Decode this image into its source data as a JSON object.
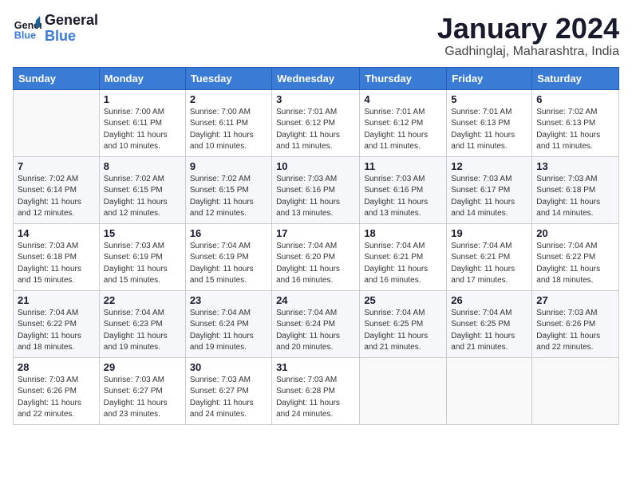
{
  "header": {
    "logo_line1": "General",
    "logo_line2": "Blue",
    "title": "January 2024",
    "location": "Gadhinglaj, Maharashtra, India"
  },
  "days_of_week": [
    "Sunday",
    "Monday",
    "Tuesday",
    "Wednesday",
    "Thursday",
    "Friday",
    "Saturday"
  ],
  "weeks": [
    [
      {
        "num": "",
        "info": ""
      },
      {
        "num": "1",
        "info": "Sunrise: 7:00 AM\nSunset: 6:11 PM\nDaylight: 11 hours\nand 10 minutes."
      },
      {
        "num": "2",
        "info": "Sunrise: 7:00 AM\nSunset: 6:11 PM\nDaylight: 11 hours\nand 10 minutes."
      },
      {
        "num": "3",
        "info": "Sunrise: 7:01 AM\nSunset: 6:12 PM\nDaylight: 11 hours\nand 11 minutes."
      },
      {
        "num": "4",
        "info": "Sunrise: 7:01 AM\nSunset: 6:12 PM\nDaylight: 11 hours\nand 11 minutes."
      },
      {
        "num": "5",
        "info": "Sunrise: 7:01 AM\nSunset: 6:13 PM\nDaylight: 11 hours\nand 11 minutes."
      },
      {
        "num": "6",
        "info": "Sunrise: 7:02 AM\nSunset: 6:13 PM\nDaylight: 11 hours\nand 11 minutes."
      }
    ],
    [
      {
        "num": "7",
        "info": "Sunrise: 7:02 AM\nSunset: 6:14 PM\nDaylight: 11 hours\nand 12 minutes."
      },
      {
        "num": "8",
        "info": "Sunrise: 7:02 AM\nSunset: 6:15 PM\nDaylight: 11 hours\nand 12 minutes."
      },
      {
        "num": "9",
        "info": "Sunrise: 7:02 AM\nSunset: 6:15 PM\nDaylight: 11 hours\nand 12 minutes."
      },
      {
        "num": "10",
        "info": "Sunrise: 7:03 AM\nSunset: 6:16 PM\nDaylight: 11 hours\nand 13 minutes."
      },
      {
        "num": "11",
        "info": "Sunrise: 7:03 AM\nSunset: 6:16 PM\nDaylight: 11 hours\nand 13 minutes."
      },
      {
        "num": "12",
        "info": "Sunrise: 7:03 AM\nSunset: 6:17 PM\nDaylight: 11 hours\nand 14 minutes."
      },
      {
        "num": "13",
        "info": "Sunrise: 7:03 AM\nSunset: 6:18 PM\nDaylight: 11 hours\nand 14 minutes."
      }
    ],
    [
      {
        "num": "14",
        "info": "Sunrise: 7:03 AM\nSunset: 6:18 PM\nDaylight: 11 hours\nand 15 minutes."
      },
      {
        "num": "15",
        "info": "Sunrise: 7:03 AM\nSunset: 6:19 PM\nDaylight: 11 hours\nand 15 minutes."
      },
      {
        "num": "16",
        "info": "Sunrise: 7:04 AM\nSunset: 6:19 PM\nDaylight: 11 hours\nand 15 minutes."
      },
      {
        "num": "17",
        "info": "Sunrise: 7:04 AM\nSunset: 6:20 PM\nDaylight: 11 hours\nand 16 minutes."
      },
      {
        "num": "18",
        "info": "Sunrise: 7:04 AM\nSunset: 6:21 PM\nDaylight: 11 hours\nand 16 minutes."
      },
      {
        "num": "19",
        "info": "Sunrise: 7:04 AM\nSunset: 6:21 PM\nDaylight: 11 hours\nand 17 minutes."
      },
      {
        "num": "20",
        "info": "Sunrise: 7:04 AM\nSunset: 6:22 PM\nDaylight: 11 hours\nand 18 minutes."
      }
    ],
    [
      {
        "num": "21",
        "info": "Sunrise: 7:04 AM\nSunset: 6:22 PM\nDaylight: 11 hours\nand 18 minutes."
      },
      {
        "num": "22",
        "info": "Sunrise: 7:04 AM\nSunset: 6:23 PM\nDaylight: 11 hours\nand 19 minutes."
      },
      {
        "num": "23",
        "info": "Sunrise: 7:04 AM\nSunset: 6:24 PM\nDaylight: 11 hours\nand 19 minutes."
      },
      {
        "num": "24",
        "info": "Sunrise: 7:04 AM\nSunset: 6:24 PM\nDaylight: 11 hours\nand 20 minutes."
      },
      {
        "num": "25",
        "info": "Sunrise: 7:04 AM\nSunset: 6:25 PM\nDaylight: 11 hours\nand 21 minutes."
      },
      {
        "num": "26",
        "info": "Sunrise: 7:04 AM\nSunset: 6:25 PM\nDaylight: 11 hours\nand 21 minutes."
      },
      {
        "num": "27",
        "info": "Sunrise: 7:03 AM\nSunset: 6:26 PM\nDaylight: 11 hours\nand 22 minutes."
      }
    ],
    [
      {
        "num": "28",
        "info": "Sunrise: 7:03 AM\nSunset: 6:26 PM\nDaylight: 11 hours\nand 22 minutes."
      },
      {
        "num": "29",
        "info": "Sunrise: 7:03 AM\nSunset: 6:27 PM\nDaylight: 11 hours\nand 23 minutes."
      },
      {
        "num": "30",
        "info": "Sunrise: 7:03 AM\nSunset: 6:27 PM\nDaylight: 11 hours\nand 24 minutes."
      },
      {
        "num": "31",
        "info": "Sunrise: 7:03 AM\nSunset: 6:28 PM\nDaylight: 11 hours\nand 24 minutes."
      },
      {
        "num": "",
        "info": ""
      },
      {
        "num": "",
        "info": ""
      },
      {
        "num": "",
        "info": ""
      }
    ]
  ]
}
